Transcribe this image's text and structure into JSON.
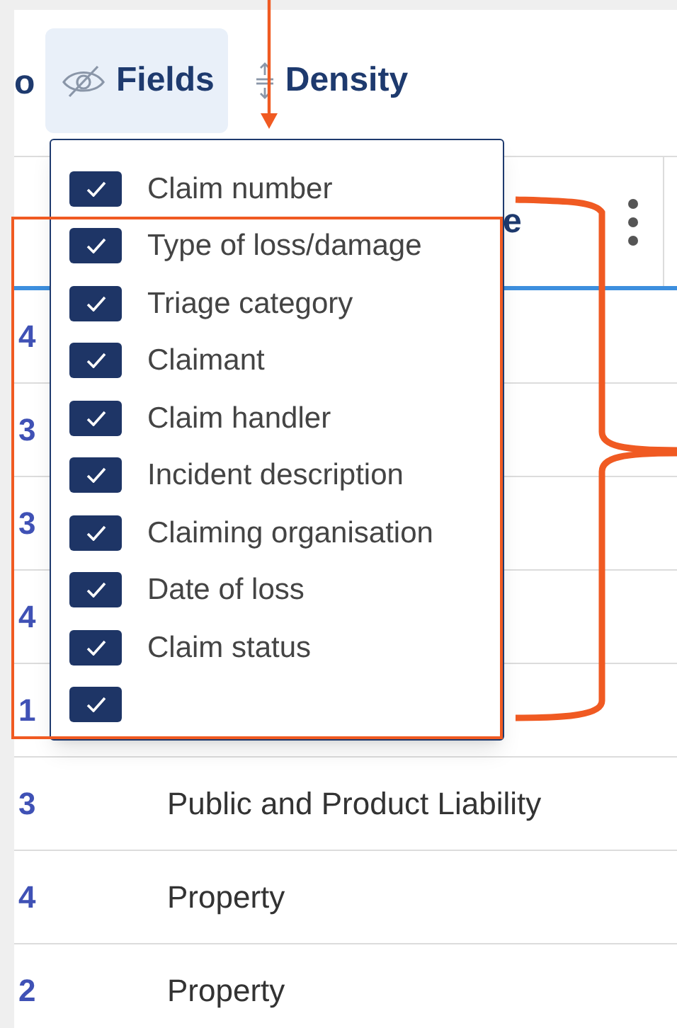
{
  "toolbar": {
    "cut_text": "o",
    "buttons": [
      {
        "label": "Fields",
        "kind": "fields",
        "selected": true
      },
      {
        "label": "Density",
        "kind": "density",
        "selected": false
      }
    ]
  },
  "table": {
    "columns": [
      {
        "label": "e"
      }
    ],
    "rows": [
      {
        "column_1": "4"
      },
      {
        "column_1": "3"
      },
      {
        "column_1": "3"
      },
      {
        "column_1": "4"
      },
      {
        "column_1": "1"
      },
      {
        "column_1": "3",
        "column_2": "Public and Product Liability"
      },
      {
        "column_1": "4",
        "column_2": "Property"
      },
      {
        "column_1": "2",
        "column_2": "Property"
      }
    ]
  },
  "fields_menu": {
    "items": [
      {
        "label": "Claim number",
        "checked": true
      },
      {
        "label": "Type of loss/damage",
        "checked": true
      },
      {
        "label": "Triage category",
        "checked": true
      },
      {
        "label": "Claimant",
        "checked": true
      },
      {
        "label": "Claim handler",
        "checked": true
      },
      {
        "label": "Incident description",
        "checked": true
      },
      {
        "label": "Claiming organisation",
        "checked": true
      },
      {
        "label": "Date of loss",
        "checked": true
      },
      {
        "label": "Claim status",
        "checked": true
      },
      {
        "checked": true
      }
    ]
  }
}
